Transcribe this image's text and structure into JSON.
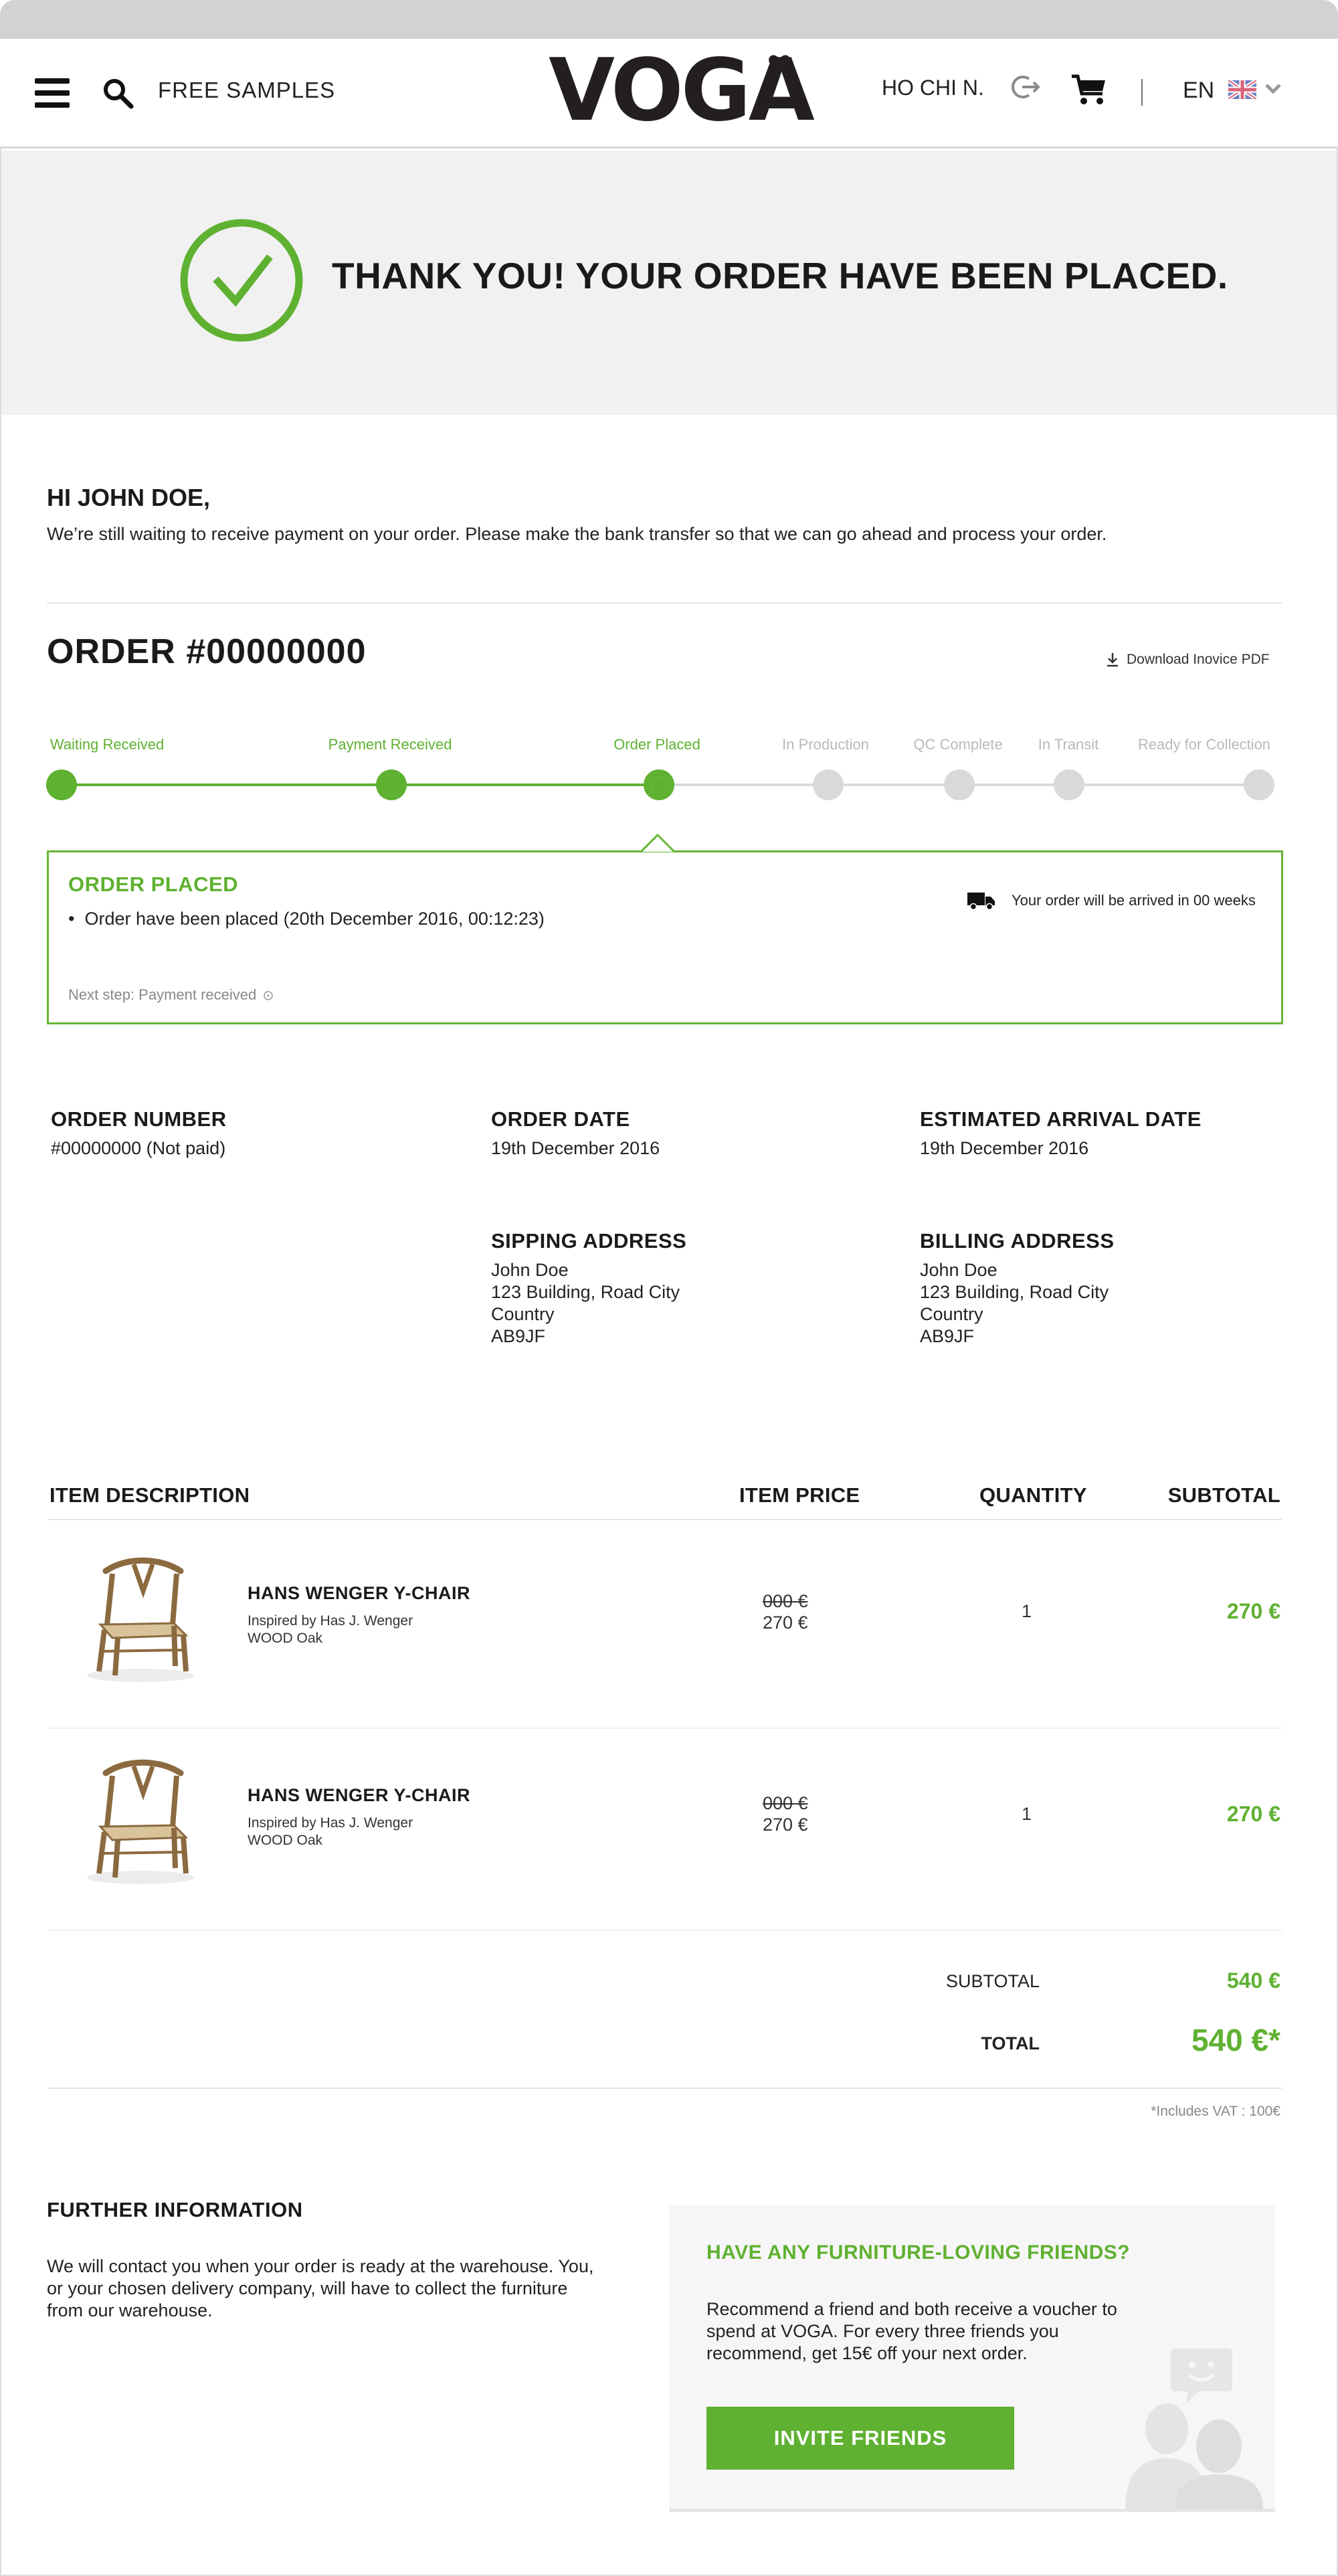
{
  "header": {
    "free_samples": "FREE SAMPLES",
    "logo": "VOGA",
    "city": "HO CHI N.",
    "language": "EN"
  },
  "banner": {
    "title": "THANK YOU! YOUR ORDER HAVE BEEN PLACED."
  },
  "greeting": {
    "title": "HI JOHN DOE,",
    "message": "We’re still waiting to receive payment on your order. Please make the bank transfer so that we can go ahead and process your order."
  },
  "order": {
    "title": "ORDER #00000000",
    "download_label": "Download Inovice PDF"
  },
  "progress": {
    "steps": [
      {
        "label": "Waiting Received",
        "state": "done"
      },
      {
        "label": "Payment Received",
        "state": "done"
      },
      {
        "label": "Order Placed",
        "state": "current"
      },
      {
        "label": "In Production",
        "state": "pending"
      },
      {
        "label": "QC Complete",
        "state": "pending"
      },
      {
        "label": "In Transit",
        "state": "pending"
      },
      {
        "label": "Ready for Collection",
        "state": "pending"
      }
    ],
    "colors": {
      "done": "#5fb131",
      "pending": "#d9d9d9"
    }
  },
  "status": {
    "title": "ORDER PLACED",
    "bullet": "Order have been placed (20th December 2016, 00:12:23)",
    "arrival": "Your order will be arrived in 00 weeks",
    "next_step": "Next step: Payment received"
  },
  "details": {
    "order_number_label": "ORDER NUMBER",
    "order_number_value": "#00000000 (Not paid)",
    "order_date_label": "ORDER DATE",
    "order_date_value": "19th December 2016",
    "arrival_label": "ESTIMATED ARRIVAL DATE",
    "arrival_value": "19th December 2016",
    "shipping_label": "SIPPING ADDRESS",
    "shipping_lines": [
      "John Doe",
      "123 Building, Road City",
      "Country",
      "AB9JF"
    ],
    "billing_label": "BILLING ADDRESS",
    "billing_lines": [
      "John Doe",
      "123 Building, Road City",
      "Country",
      "AB9JF"
    ]
  },
  "table": {
    "headers": {
      "description": "ITEM DESCRIPTION",
      "price": "ITEM PRICE",
      "quantity": "QUANTITY",
      "subtotal": "SUBTOTAL"
    },
    "items": [
      {
        "name": "HANS WENGER Y-CHAIR",
        "designer": "Inspired by Has J. Wenger",
        "material": "WOOD Oak",
        "old_price": "000 €",
        "price": "270 €",
        "quantity": "1",
        "subtotal": "270 €"
      },
      {
        "name": "HANS WENGER Y-CHAIR",
        "designer": "Inspired by Has J. Wenger",
        "material": "WOOD Oak",
        "old_price": "000 €",
        "price": "270 €",
        "quantity": "1",
        "subtotal": "270 €"
      }
    ]
  },
  "totals": {
    "subtotal_label": "SUBTOTAL",
    "subtotal_value": "540 €",
    "total_label": "TOTAL",
    "total_value": "540 €*",
    "vat_note": "*Includes VAT : 100€"
  },
  "further": {
    "title": "FURTHER INFORMATION",
    "text": "We will contact you when your order is ready at the warehouse. You, or your chosen delivery company, will have to collect the furniture from our warehouse."
  },
  "friends": {
    "title": "HAVE ANY FURNITURE-LOVING FRIENDS?",
    "text": "Recommend a friend and both receive a voucher to spend at VOGA. For every three friends you recommend, get 15€ off your next order.",
    "button": "INVITE FRIENDS"
  },
  "colors": {
    "accent": "#5fb131",
    "text": "#1a1a1a",
    "banner_bg": "#f1f1f1"
  }
}
